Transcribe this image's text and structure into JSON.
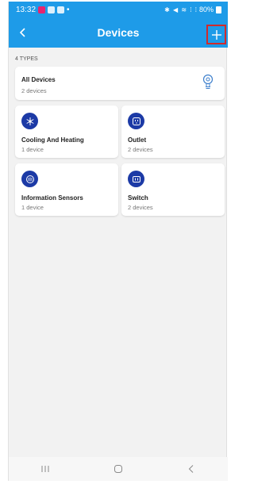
{
  "status_bar": {
    "time": "13:32",
    "dot": "•",
    "system_icons": "✱ ◀ ≋ ⁞ ⁞",
    "battery": "80%"
  },
  "app_bar": {
    "title": "Devices",
    "back_icon": "chevron-left-icon",
    "add_icon": "plus-icon"
  },
  "types_label": "4 TYPES",
  "all_devices": {
    "name": "All Devices",
    "count": "2 devices",
    "icon": "lightbulb-icon"
  },
  "device_types": [
    {
      "name": "Cooling And Heating",
      "count": "1 device",
      "icon": "snowflake-sun-icon"
    },
    {
      "name": "Outlet",
      "count": "2 devices",
      "icon": "outlet-icon"
    },
    {
      "name": "Information Sensors",
      "count": "1 device",
      "icon": "sensor-icon"
    },
    {
      "name": "Switch",
      "count": "2 devices",
      "icon": "switch-icon"
    }
  ],
  "colors": {
    "primary": "#1e9be8",
    "icon_circle": "#1c3aa6",
    "highlight": "#d22a2a",
    "background": "#f2f2f2"
  },
  "nav_bar": {
    "recents_icon": "recents-icon",
    "home_icon": "home-icon",
    "back_icon": "back-icon"
  }
}
